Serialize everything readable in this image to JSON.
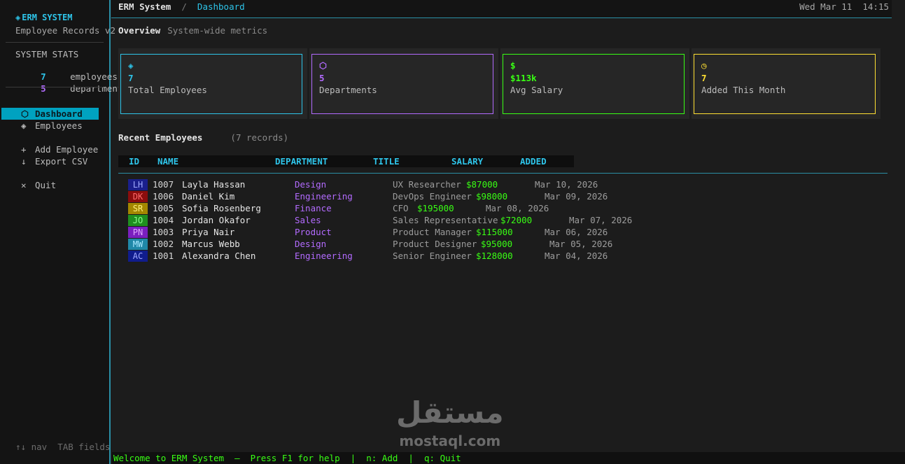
{
  "sidebar": {
    "brand_glyph": "◈",
    "brand": "ERM SYSTEM",
    "subtitle": "Employee Records v2",
    "stats_title": "SYSTEM STATS",
    "stats": [
      {
        "value": "7",
        "label": "employees",
        "color": "#2ec5ea"
      },
      {
        "value": "5",
        "label": "departments",
        "color": "#b36bff"
      }
    ],
    "nav": [
      {
        "icon": "⬡",
        "label": "Dashboard",
        "active": true
      },
      {
        "icon": "◈",
        "label": "Employees",
        "active": false
      }
    ],
    "actions": [
      {
        "icon": "+",
        "label": "Add Employee"
      },
      {
        "icon": "↓",
        "label": "Export CSV"
      }
    ],
    "quit": {
      "icon": "✕",
      "label": "Quit"
    },
    "footer": "↑↓ nav  TAB fields"
  },
  "topbar": {
    "app": "ERM System",
    "separator": "/",
    "current": "Dashboard",
    "datetime": "Wed Mar 11  14:15"
  },
  "overview": {
    "title": "Overview",
    "subtitle": "System-wide metrics"
  },
  "cards": [
    {
      "icon": "◈",
      "value": "7",
      "label": "Total Employees",
      "color": "#2ec5ea"
    },
    {
      "icon": "⬡",
      "value": "5",
      "label": "Departments",
      "color": "#b36bff"
    },
    {
      "icon": "$",
      "value": "$113k",
      "label": "Avg Salary",
      "color": "#39ff14"
    },
    {
      "icon": "◷",
      "value": "7",
      "label": "Added This Month",
      "color": "#ffe033"
    }
  ],
  "recent": {
    "title": "Recent Employees",
    "count": "(7 records)"
  },
  "table": {
    "headers": [
      "ID",
      "NAME",
      "DEPARTMENT",
      "TITLE",
      "SALARY",
      "ADDED"
    ],
    "rows": [
      {
        "initials": "LH",
        "av_bg": "#1a1f8c",
        "av_fg": "#9fa8ff",
        "id": "1007",
        "name": "Layla Hassan",
        "dept": "Design",
        "title": "UX Researcher",
        "salary": "$87000",
        "added": "Mar 10, 2026"
      },
      {
        "initials": "DK",
        "av_bg": "#8b0d0d",
        "av_fg": "#ff6b6b",
        "id": "1006",
        "name": "Daniel Kim",
        "dept": "Engineering",
        "title": "DevOps Engineer",
        "salary": "$98000",
        "added": "Mar 09, 2026"
      },
      {
        "initials": "SR",
        "av_bg": "#a48700",
        "av_fg": "#fff07a",
        "id": "1005",
        "name": "Sofia Rosenberg",
        "dept": "Finance",
        "title": "CFO",
        "salary": "$195000",
        "added": "Mar 08, 2026"
      },
      {
        "initials": "JO",
        "av_bg": "#1f8f1f",
        "av_fg": "#8cff8c",
        "id": "1004",
        "name": "Jordan Okafor",
        "dept": "Sales",
        "title": "Sales Representative",
        "salary": "$72000",
        "added": "Mar 07, 2026"
      },
      {
        "initials": "PN",
        "av_bg": "#7a1fbf",
        "av_fg": "#e0a8ff",
        "id": "1003",
        "name": "Priya Nair",
        "dept": "Product",
        "title": "Product Manager",
        "salary": "$115000",
        "added": "Mar 06, 2026"
      },
      {
        "initials": "MW",
        "av_bg": "#1f88a8",
        "av_fg": "#a8e8ff",
        "id": "1002",
        "name": "Marcus Webb",
        "dept": "Design",
        "title": "Product Designer",
        "salary": "$95000",
        "added": "Mar 05, 2026"
      },
      {
        "initials": "AC",
        "av_bg": "#101c8c",
        "av_fg": "#9fa8ff",
        "id": "1001",
        "name": "Alexandra Chen",
        "dept": "Engineering",
        "title": "Senior Engineer",
        "salary": "$128000",
        "added": "Mar 04, 2026"
      }
    ]
  },
  "status": "Welcome to ERM System  —  Press F1 for help  |  n: Add  |  q: Quit",
  "watermark": {
    "arabic": "مستقل",
    "latin": "mostaql.com"
  }
}
